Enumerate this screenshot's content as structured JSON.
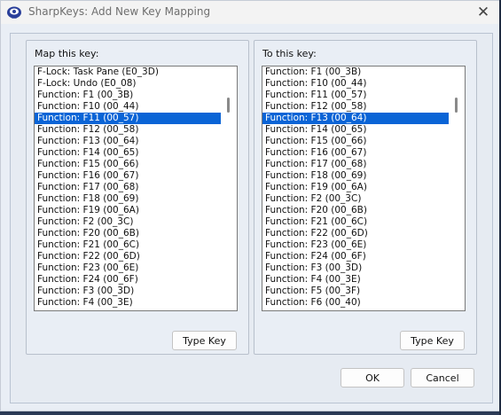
{
  "window": {
    "title": "SharpKeys: Add New Key Mapping",
    "close_glyph": "✕"
  },
  "left_group": {
    "label": "Map this key:",
    "items": [
      "F-Lock: Task Pane (E0_3D)",
      "F-Lock: Undo (E0_08)",
      "Function: F1 (00_3B)",
      "Function: F10 (00_44)",
      "Function: F11 (00_57)",
      "Function: F12 (00_58)",
      "Function: F13 (00_64)",
      "Function: F14 (00_65)",
      "Function: F15 (00_66)",
      "Function: F16 (00_67)",
      "Function: F17 (00_68)",
      "Function: F18 (00_69)",
      "Function: F19 (00_6A)",
      "Function: F2 (00_3C)",
      "Function: F20 (00_6B)",
      "Function: F21 (00_6C)",
      "Function: F22 (00_6D)",
      "Function: F23 (00_6E)",
      "Function: F24 (00_6F)",
      "Function: F3 (00_3D)",
      "Function: F4 (00_3E)"
    ],
    "selected_index": 4,
    "type_key_label": "Type Key"
  },
  "right_group": {
    "label": "To this key:",
    "items": [
      "Function: F1 (00_3B)",
      "Function: F10 (00_44)",
      "Function: F11 (00_57)",
      "Function: F12 (00_58)",
      "Function: F13 (00_64)",
      "Function: F14 (00_65)",
      "Function: F15 (00_66)",
      "Function: F16 (00_67)",
      "Function: F17 (00_68)",
      "Function: F18 (00_69)",
      "Function: F19 (00_6A)",
      "Function: F2 (00_3C)",
      "Function: F20 (00_6B)",
      "Function: F21 (00_6C)",
      "Function: F22 (00_6D)",
      "Function: F23 (00_6E)",
      "Function: F24 (00_6F)",
      "Function: F3 (00_3D)",
      "Function: F4 (00_3E)",
      "Function: F5 (00_3F)",
      "Function: F6 (00_40)"
    ],
    "selected_index": 4,
    "type_key_label": "Type Key"
  },
  "buttons": {
    "ok_label": "OK",
    "cancel_label": "Cancel"
  },
  "icons": {
    "app": "sharpkeys-app-icon",
    "close": "close-icon"
  },
  "colors": {
    "selection": "#0a64d6",
    "dialog_bg": "#e9eef5"
  }
}
